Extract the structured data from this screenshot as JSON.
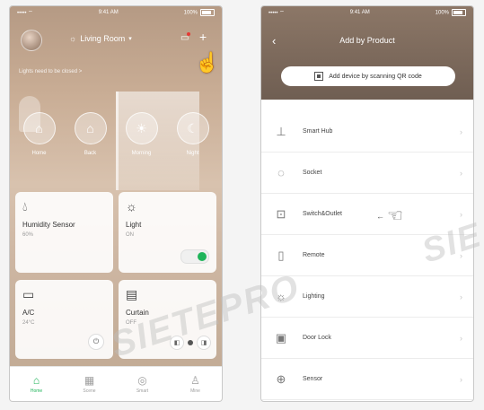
{
  "left_phone": {
    "status_bar": {
      "carrier": "•••••  ⌔",
      "time": "9:41 AM",
      "battery": "100%"
    },
    "header": {
      "room_name": "Living Room",
      "add_icon": "plus-icon",
      "notify_icon": "bell-icon"
    },
    "scene_message": "Lights need to be closed >",
    "scenes": [
      {
        "label": "Home",
        "icon": "home-icon"
      },
      {
        "label": "Back",
        "icon": "back-home-icon"
      },
      {
        "label": "Morning",
        "icon": "sunrise-icon"
      },
      {
        "label": "Night",
        "icon": "moon-icon"
      }
    ],
    "devices": [
      {
        "name": "Humidity Sensor",
        "status": "60%",
        "icon": "droplet-icon"
      },
      {
        "name": "Light",
        "status": "ON",
        "icon": "bulb-icon",
        "toggle_on": true
      },
      {
        "name": "A/C",
        "status": "24°C",
        "icon": "ac-icon"
      },
      {
        "name": "Curtain",
        "status": "OFF",
        "icon": "curtain-icon"
      }
    ],
    "tabs": [
      {
        "label": "Home",
        "icon": "home-icon",
        "active": true
      },
      {
        "label": "Scene",
        "icon": "scene-icon",
        "active": false
      },
      {
        "label": "Smart",
        "icon": "smart-icon",
        "active": false
      },
      {
        "label": "Mine",
        "icon": "user-icon",
        "active": false
      }
    ],
    "accent_color": "#1fb45a"
  },
  "right_phone": {
    "status_bar": {
      "carrier": "•••••  ⌔",
      "time": "9:41 AM",
      "battery": "100%"
    },
    "title": "Add by Product",
    "scan_button": "Add device by scanning QR code",
    "products": [
      {
        "label": "Smart Hub",
        "icon": "hub-icon"
      },
      {
        "label": "Socket",
        "icon": "socket-icon"
      },
      {
        "label": "Switch&Outlet",
        "icon": "switch-icon"
      },
      {
        "label": "Remote",
        "icon": "remote-icon"
      },
      {
        "label": "Lighting",
        "icon": "bulb-icon"
      },
      {
        "label": "Door Lock",
        "icon": "lock-icon"
      },
      {
        "label": "Sensor",
        "icon": "sensor-icon"
      }
    ]
  },
  "watermark": "SIETEPRO"
}
